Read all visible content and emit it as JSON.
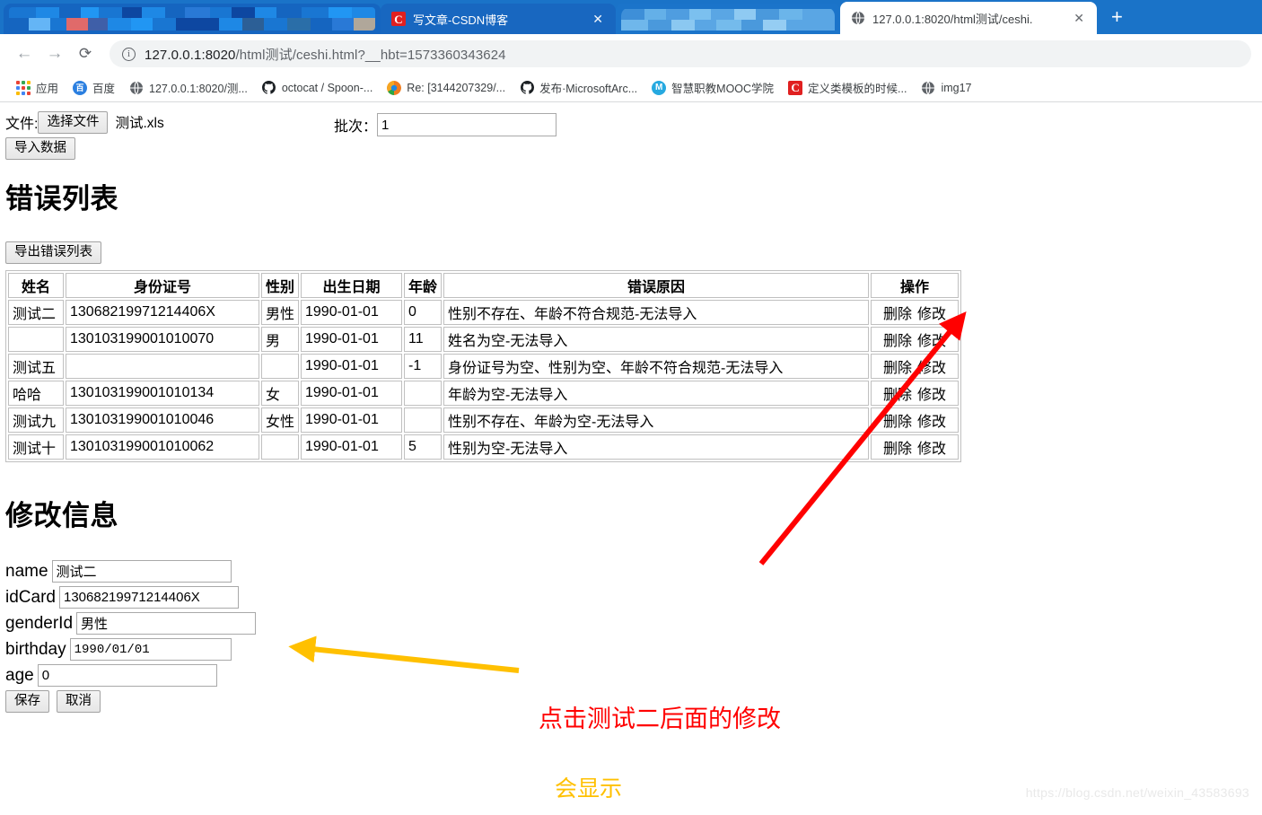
{
  "browser": {
    "tabs": [
      {
        "title": "",
        "favicon": "blurred-icon",
        "censored": true,
        "active": false
      },
      {
        "title": "写文章-CSDN博客",
        "favicon": "csdn-icon",
        "censored": false,
        "active": false
      },
      {
        "title": "",
        "favicon": "blurred-icon",
        "censored": true,
        "active": false
      },
      {
        "title": "127.0.0.1:8020/html测试/ceshi.",
        "favicon": "globe-icon",
        "censored": false,
        "active": true
      }
    ],
    "new_tab_label": "+",
    "close_label": "✕",
    "nav": {
      "back": "←",
      "forward": "→",
      "reload": "⟳"
    },
    "omnibox": {
      "info_icon": "ⓘ",
      "url_host": "127.0.0.1:8020",
      "url_path": "/html测试/ceshi.html?__hbt=1573360343624",
      "url_full": "127.0.0.1:8020/html测试/ceshi.html?__hbt=1573360343624"
    },
    "bookmarks": [
      {
        "label": "应用",
        "icon": "apps-grid-icon"
      },
      {
        "label": "百度",
        "icon": "baidu-icon"
      },
      {
        "label": "127.0.0.1:8020/测...",
        "icon": "globe-icon"
      },
      {
        "label": "octocat / Spoon-...",
        "icon": "github-icon"
      },
      {
        "label": "Re: [3144207329/...",
        "icon": "orange-circle-icon"
      },
      {
        "label": "发布·MicrosoftArc...",
        "icon": "github-icon"
      },
      {
        "label": "智慧职教MOOC学院",
        "icon": "mooc-icon"
      },
      {
        "label": "定义类模板的时候...",
        "icon": "csdn-icon"
      },
      {
        "label": "img17",
        "icon": "globe-icon"
      }
    ]
  },
  "page": {
    "upload": {
      "file_label": "文件:",
      "choose_button": "选择文件",
      "file_name": "测试.xls",
      "batch_label": "批次：",
      "batch_value": "1",
      "import_button": "导入数据"
    },
    "error_section": {
      "heading": "错误列表",
      "export_button": "导出错误列表",
      "columns": [
        "姓名",
        "身份证号",
        "性别",
        "出生日期",
        "年龄",
        "错误原因",
        "操作"
      ],
      "actions": {
        "delete": "删除",
        "edit": "修改"
      },
      "rows": [
        {
          "name": "测试二",
          "idcard": "13068219971214406X",
          "gender": "男性",
          "birthday": "1990-01-01",
          "age": "0",
          "reason": "性别不存在、年龄不符合规范-无法导入"
        },
        {
          "name": "",
          "idcard": "130103199001010070",
          "gender": "男",
          "birthday": "1990-01-01",
          "age": "11",
          "reason": "姓名为空-无法导入"
        },
        {
          "name": "测试五",
          "idcard": "",
          "gender": "",
          "birthday": "1990-01-01",
          "age": "-1",
          "reason": "身份证号为空、性别为空、年龄不符合规范-无法导入"
        },
        {
          "name": "哈哈",
          "idcard": "130103199001010134",
          "gender": "女",
          "birthday": "1990-01-01",
          "age": "",
          "reason": "年龄为空-无法导入"
        },
        {
          "name": "测试九",
          "idcard": "130103199001010046",
          "gender": "女性",
          "birthday": "1990-01-01",
          "age": "",
          "reason": "性别不存在、年龄为空-无法导入"
        },
        {
          "name": "测试十",
          "idcard": "130103199001010062",
          "gender": "",
          "birthday": "1990-01-01",
          "age": "5",
          "reason": "性别为空-无法导入"
        }
      ]
    },
    "edit_section": {
      "heading": "修改信息",
      "fields": [
        {
          "label": "name",
          "value": "测试二"
        },
        {
          "label": "idCard",
          "value": "13068219971214406X"
        },
        {
          "label": "genderId",
          "value": "男性"
        },
        {
          "label": "birthday",
          "value": "1990/01/01"
        },
        {
          "label": "age",
          "value": "0"
        }
      ],
      "save_button": "保存",
      "cancel_button": "取消"
    },
    "annotations": [
      {
        "text": "点击测试二后面的修改",
        "color": "#ff0000"
      },
      {
        "text": "会显示",
        "color": "#ffc000"
      }
    ],
    "watermark": "https://blog.csdn.net/weixin_43583693"
  },
  "colors": {
    "browser_blue": "#1a73c8",
    "red_annotation": "#ff0000",
    "orange_annotation": "#ffc000",
    "csdn_red": "#e02020"
  }
}
